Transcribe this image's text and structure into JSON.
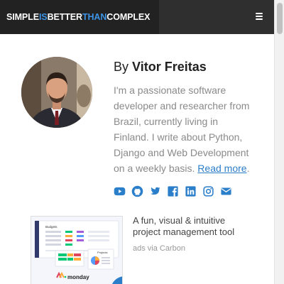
{
  "navbar": {
    "brand_parts": [
      "SIMPLE",
      "IS",
      "BETTER",
      "THAN",
      "COMPLEX"
    ],
    "brand_color_white": "#ffffff",
    "brand_color_blue": "#3d93e5",
    "menu_icon": "hamburger-menu-icon"
  },
  "author": {
    "by_label": "By",
    "name": "Vitor Freitas",
    "bio": "I'm a passionate software developer and researcher from Brazil, currently living in Finland. I write about Python, Django and Web Development on a weekly basis.",
    "read_more": "Read more",
    "trailing_period": "."
  },
  "social": {
    "icons": [
      "youtube-icon",
      "github-icon",
      "twitter-icon",
      "facebook-icon",
      "linkedin-icon",
      "instagram-icon",
      "email-icon"
    ],
    "color": "#2b7ec9"
  },
  "ad": {
    "text": "A fun, visual & intuitive project management tool",
    "via": "ads via Carbon",
    "image_labels": {
      "budgets": "Budgets",
      "projects": "Projects",
      "logo": "monday"
    }
  }
}
